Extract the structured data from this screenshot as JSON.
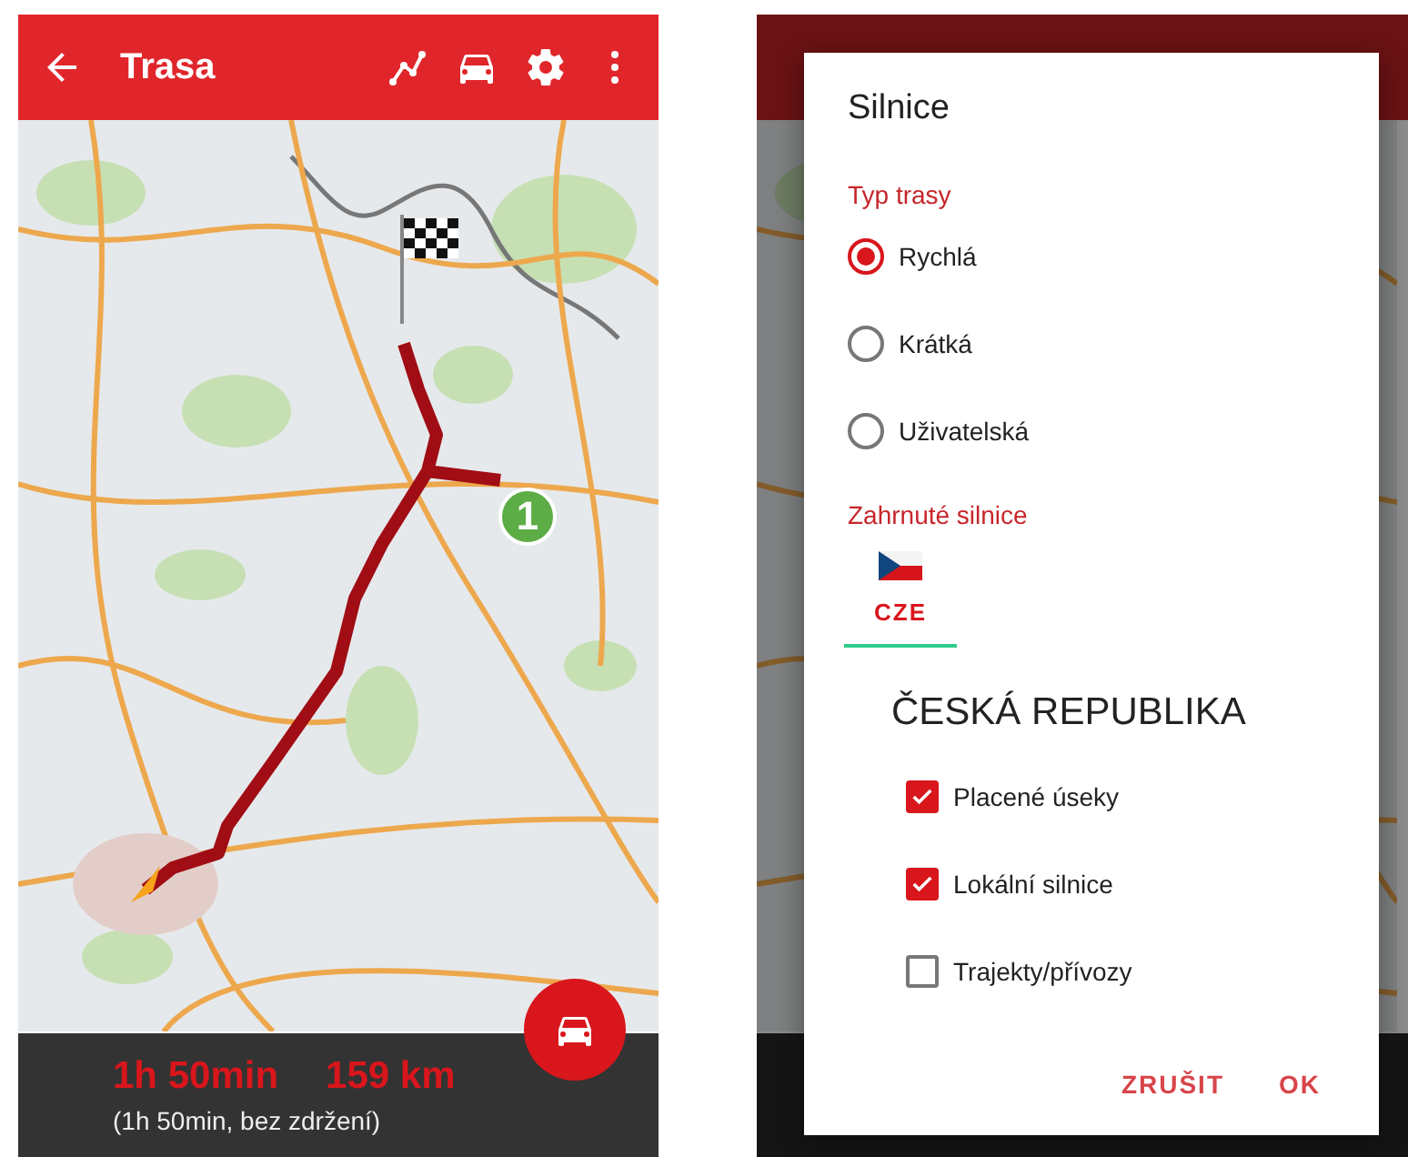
{
  "route_screen": {
    "toolbar": {
      "title": "Trasa"
    },
    "map": {
      "waypoint_label": "1"
    },
    "summary": {
      "time": "1h 50min",
      "distance": "159 km",
      "detail": "(1h 50min, bez zdržení)"
    }
  },
  "road_dialog": {
    "title": "Silnice",
    "route_type": {
      "heading": "Typ trasy",
      "options": [
        {
          "label": "Rychlá",
          "selected": true
        },
        {
          "label": "Krátká",
          "selected": false
        },
        {
          "label": "Uživatelská",
          "selected": false
        }
      ]
    },
    "included_roads": {
      "heading": "Zahrnuté silnice",
      "tabs": [
        {
          "label": "CZE",
          "selected": true
        }
      ],
      "country": "ČESKÁ REPUBLIKA",
      "options": [
        {
          "label": "Placené úseky",
          "checked": true
        },
        {
          "label": "Lokální silnice",
          "checked": true
        },
        {
          "label": "Trajekty/přívozy",
          "checked": false
        }
      ]
    },
    "buttons": [
      "ZRUŠIT",
      "OK"
    ]
  }
}
